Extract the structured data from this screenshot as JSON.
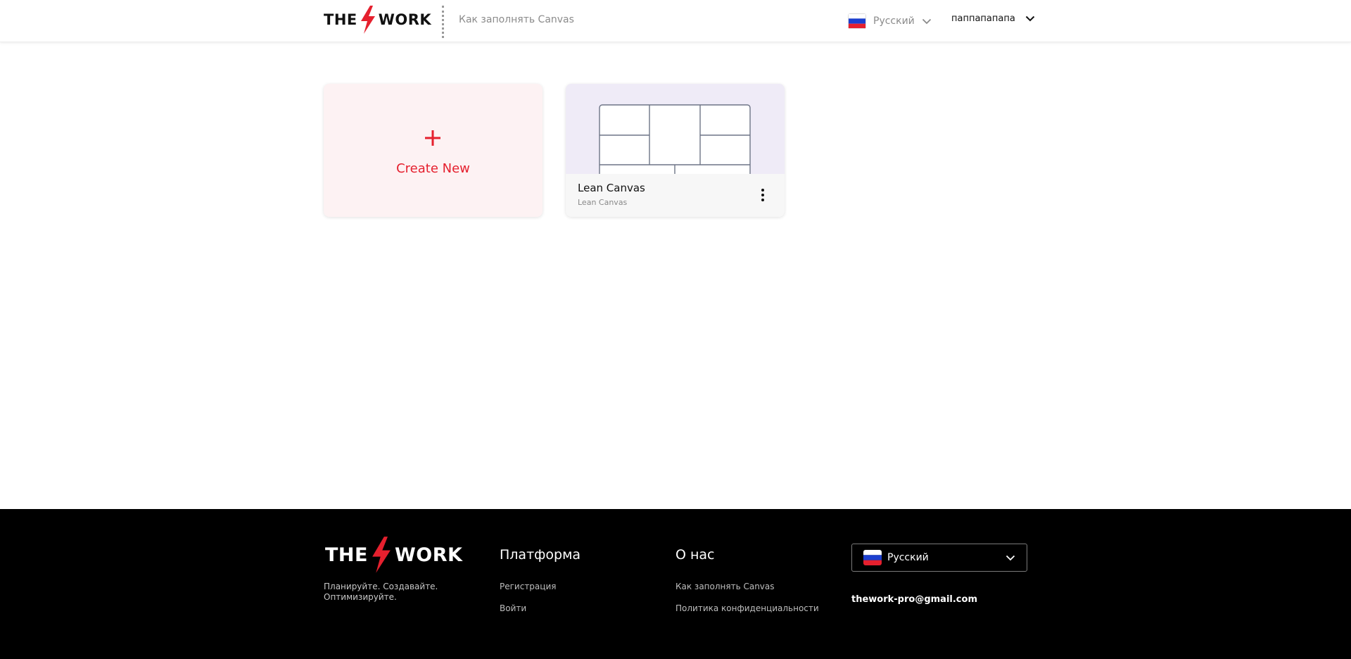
{
  "header": {
    "logo": {
      "left": "THE",
      "right": "WORK"
    },
    "nav_link": "Как заполнять Canvas",
    "language": {
      "label": "Русский",
      "icon": "flag-ru-icon"
    },
    "user": {
      "name": "паппапапапа",
      "icon": "chevron-down-icon"
    }
  },
  "cards": {
    "create": {
      "label": "Create New",
      "icon": "plus-icon"
    },
    "items": [
      {
        "title": "Lean Canvas",
        "subtitle": "Lean Canvas",
        "menu_icon": "more-vertical-icon"
      }
    ]
  },
  "footer": {
    "logo": {
      "left": "THE",
      "right": "WORK"
    },
    "tagline": "Планируйте. Создавайте. Оптимизируйте.",
    "columns": [
      {
        "heading": "Платформа",
        "links": [
          "Регистрация",
          "Войти"
        ]
      },
      {
        "heading": "О нас",
        "links": [
          "Как заполнять Canvas",
          "Политика конфиденциальности"
        ]
      }
    ],
    "language": {
      "label": "Русский",
      "icon": "flag-ru-icon"
    },
    "email": "thework-pro@gmail.com"
  },
  "colors": {
    "accent": "#e5202e",
    "create_card_bg": "#fdf2f3",
    "preview_bg": "#efebf7",
    "footer_bg": "#000000"
  }
}
